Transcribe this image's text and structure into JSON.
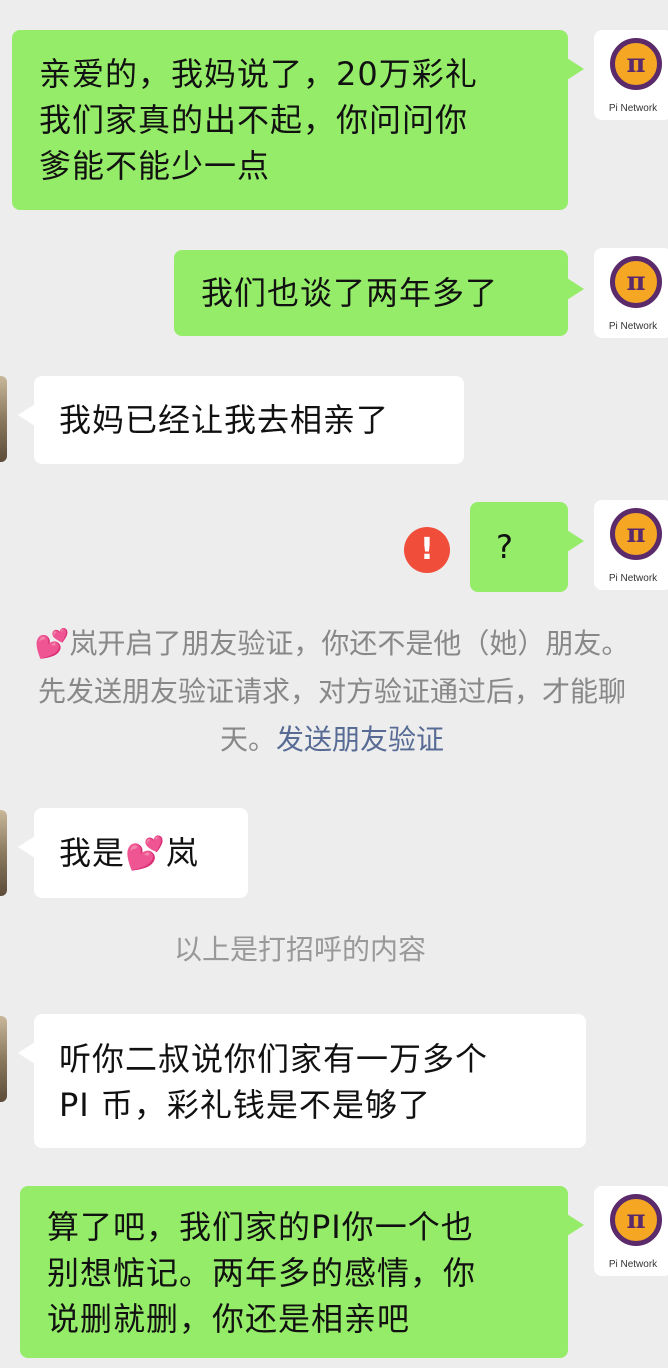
{
  "self_avatar": {
    "caption": "Pi Network",
    "glyph": "π"
  },
  "messages": [
    {
      "lines": [
        "亲爱的，我妈说了，20万彩礼",
        "我们家真的出不起，你问问你",
        "爹能不能少一点"
      ]
    },
    {
      "lines": [
        "我们也谈了两年多了"
      ]
    },
    {
      "lines": [
        "我妈已经让我去相亲了"
      ]
    },
    {
      "lines": [
        "?"
      ],
      "status": "!"
    },
    {
      "lines": [
        "我是",
        "💕",
        "岚"
      ]
    },
    {
      "lines": [
        "听你二叔说你们家有一万多个",
        "PI 币，彩礼钱是不是够了"
      ]
    },
    {
      "lines": [
        "算了吧，我们家的PI你一个也",
        "别想惦记。两年多的感情，你",
        "说删就删，你还是相亲吧"
      ]
    }
  ],
  "system_notice": {
    "line1": "💕岚开启了朋友验证，你还不是他（她）朋友。",
    "line2": "先发送朋友验证请求，对方验证通过后，才能聊",
    "line3": "天。",
    "link": "发送朋友验证"
  },
  "greeting_divider": "以上是打招呼的内容",
  "colors": {
    "background": "#ededed",
    "outgoing_bubble": "#95ec69",
    "incoming_bubble": "#ffffff",
    "error": "#f04d3a",
    "link": "#576b95",
    "system_text": "#888888"
  },
  "icons": {
    "self_avatar": "pi-network-logo",
    "send_failed": "exclamation-circle-icon"
  }
}
